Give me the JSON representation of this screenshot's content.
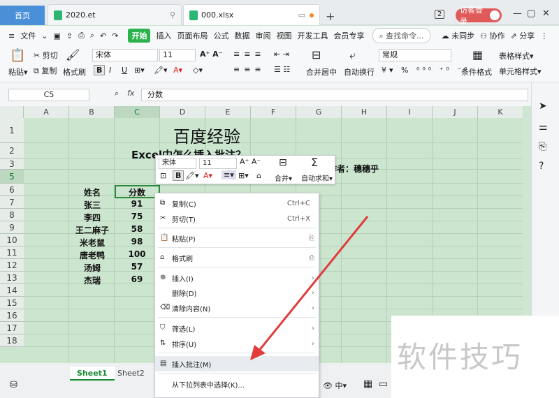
{
  "tabs": {
    "home": "首页",
    "doc1": "2020.et",
    "doc2": "000.xlsx"
  },
  "titlebar": {
    "badge": "2",
    "visitor": "访客登录"
  },
  "menu": {
    "file": "文件",
    "items": [
      "开始",
      "插入",
      "页面布局",
      "公式",
      "数据",
      "审阅",
      "视图",
      "开发工具",
      "会员专享"
    ],
    "search": "查找命令...",
    "right": [
      "未同步",
      "协作",
      "分享"
    ]
  },
  "ribbon": {
    "paste": "粘贴",
    "cut": "剪切",
    "copy": "复制",
    "format_painter": "格式刷",
    "font_name": "宋体",
    "font_size": "11",
    "merge_center": "合并居中",
    "wrap": "自动换行",
    "number_format": "常规",
    "cond_format": "条件格式",
    "table_style": "表格样式",
    "cell_style": "单元格样式"
  },
  "formula_bar": {
    "cell_ref": "C5",
    "fx": "fx",
    "value": "分数"
  },
  "sheet": {
    "columns": [
      "A",
      "B",
      "C",
      "D",
      "E",
      "F",
      "G",
      "H",
      "I",
      "J",
      "K"
    ],
    "rows": [
      "1",
      "2",
      "3",
      "4",
      "5",
      "6",
      "7",
      "8",
      "9",
      "10",
      "11",
      "12",
      "13",
      "14",
      "15",
      "16",
      "17",
      "18"
    ],
    "title": "百度经验",
    "subtitle": "Excel中怎么插入批注？",
    "author": "作者：穗穗乎",
    "header_name": "姓名",
    "header_score": "分数",
    "records": [
      {
        "name": "张三",
        "score": "91"
      },
      {
        "name": "李四",
        "score": "75"
      },
      {
        "name": "王二麻子",
        "score": "58"
      },
      {
        "name": "米老鼠",
        "score": "98"
      },
      {
        "name": "唐老鸭",
        "score": "100"
      },
      {
        "name": "汤姆",
        "score": "57"
      },
      {
        "name": "杰瑞",
        "score": "69"
      }
    ]
  },
  "mini_toolbar": {
    "font_name": "宋体",
    "font_size": "11",
    "merge": "合并",
    "autosum": "自动求和"
  },
  "context_menu": [
    {
      "label": "复制(C)",
      "key": "Ctrl+C"
    },
    {
      "label": "剪切(T)",
      "key": "Ctrl+X"
    },
    {
      "label": "粘贴(P)",
      "key": ""
    },
    {
      "label": "格式刷",
      "key": ""
    },
    {
      "label": "插入(I)",
      "key": ""
    },
    {
      "label": "删除(D)",
      "key": ""
    },
    {
      "label": "清除内容(N)",
      "key": ""
    },
    {
      "label": "筛选(L)",
      "key": ""
    },
    {
      "label": "排序(U)",
      "key": ""
    },
    {
      "label": "插入批注(M)",
      "key": ""
    },
    {
      "label": "从下拉列表中选择(K)...",
      "key": ""
    }
  ],
  "sheet_tabs": [
    "Sheet1",
    "Sheet2"
  ],
  "watermark": "软件技巧",
  "colors": {
    "accent_green": "#2bb24c",
    "home_tab": "#4a90d9",
    "arrow": "#e03c3c",
    "sheet_bg": "#cbe5cf"
  }
}
